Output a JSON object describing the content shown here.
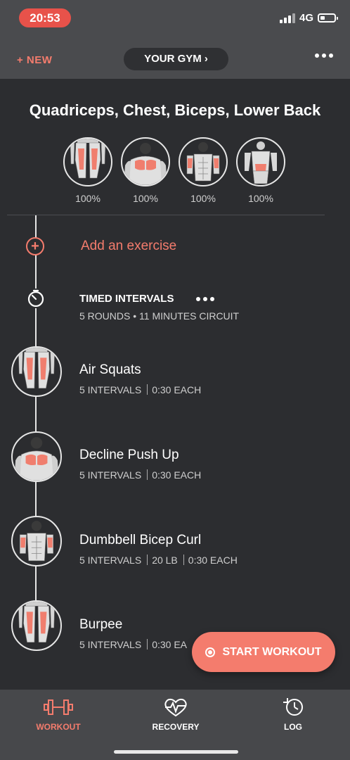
{
  "status_bar": {
    "time": "20:53",
    "network": "4G"
  },
  "header": {
    "new_label": "+ NEW",
    "gym_label": "YOUR GYM ›",
    "more_icon": "more-icon"
  },
  "workout": {
    "title": "Quadriceps, Chest, Biceps, Lower Back",
    "muscles": [
      {
        "name": "quadriceps-icon",
        "percent": "100%"
      },
      {
        "name": "chest-icon",
        "percent": "100%"
      },
      {
        "name": "biceps-icon",
        "percent": "100%"
      },
      {
        "name": "lower-back-icon",
        "percent": "100%"
      }
    ]
  },
  "add_exercise_label": "Add an exercise",
  "interval": {
    "title": "TIMED INTERVALS",
    "subtitle": "5 ROUNDS • 11 MINUTES CIRCUIT"
  },
  "exercises": [
    {
      "name": "Air Squats",
      "meta": [
        "5 INTERVALS",
        "0:30 EACH"
      ],
      "muscle_icon": "quadriceps-icon"
    },
    {
      "name": "Decline Push Up",
      "meta": [
        "5 INTERVALS",
        "0:30 EACH"
      ],
      "muscle_icon": "chest-icon"
    },
    {
      "name": "Dumbbell Bicep Curl",
      "meta": [
        "5 INTERVALS",
        "20 LB",
        "0:30 EACH"
      ],
      "muscle_icon": "biceps-icon"
    },
    {
      "name": "Burpee",
      "meta": [
        "5 INTERVALS",
        "0:30 EA"
      ],
      "muscle_icon": "quadriceps-icon"
    }
  ],
  "start_button": {
    "label": "START WORKOUT"
  },
  "nav": [
    {
      "label": "WORKOUT",
      "icon": "dumbbell-icon",
      "active": true
    },
    {
      "label": "RECOVERY",
      "icon": "recovery-heart-icon",
      "active": false
    },
    {
      "label": "LOG",
      "icon": "log-clock-icon",
      "active": false
    }
  ],
  "colors": {
    "accent": "#f47c6d",
    "background": "#2c2d30",
    "bar": "#4a4b4e",
    "status_pill": "#e8524a"
  }
}
